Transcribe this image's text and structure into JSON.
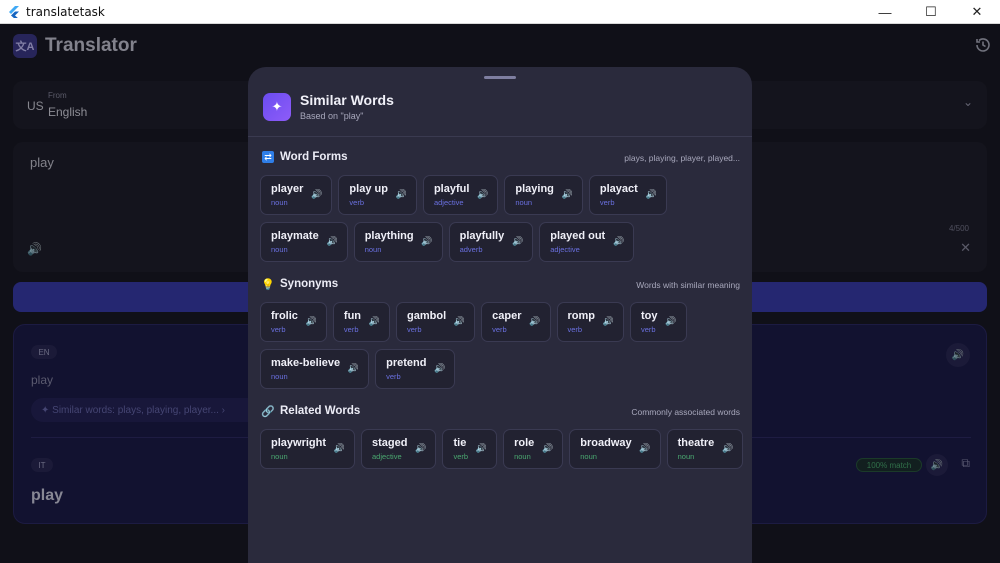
{
  "window": {
    "title": "translatetask",
    "minimize": "—",
    "maximize": "☐",
    "close": "✕"
  },
  "app": {
    "logo": "文A",
    "title": "Translator",
    "language": {
      "code": "US",
      "from_label": "From",
      "name": "English"
    },
    "input": {
      "text": "play",
      "char_count": "4/500"
    },
    "result": {
      "source_badge": "EN",
      "source_text": "play",
      "similar_chip": "✦  Similar words: plays, playing, player...  ›",
      "target_badge": "IT",
      "target_text": "play",
      "match": "100% match"
    }
  },
  "sheet": {
    "title": "Similar Words",
    "subtitle": "Based on \"play\"",
    "sections": [
      {
        "title": "Word Forms",
        "note": "plays, playing, player, played...",
        "icon": "shuffle-icon",
        "color": "#2f7ee8",
        "chips": [
          {
            "word": "player",
            "pos": "noun"
          },
          {
            "word": "play up",
            "pos": "verb"
          },
          {
            "word": "playful",
            "pos": "adjective"
          },
          {
            "word": "playing",
            "pos": "noun"
          },
          {
            "word": "playact",
            "pos": "verb"
          },
          {
            "word": "playmate",
            "pos": "noun"
          },
          {
            "word": "plaything",
            "pos": "noun"
          },
          {
            "word": "playfully",
            "pos": "adverb"
          },
          {
            "word": "played out",
            "pos": "adjective"
          }
        ]
      },
      {
        "title": "Synonyms",
        "note": "Words with similar meaning",
        "icon": "lightbulb-icon",
        "color": "#f2c230",
        "chips": [
          {
            "word": "frolic",
            "pos": "verb"
          },
          {
            "word": "fun",
            "pos": "verb"
          },
          {
            "word": "gambol",
            "pos": "verb"
          },
          {
            "word": "caper",
            "pos": "verb"
          },
          {
            "word": "romp",
            "pos": "verb"
          },
          {
            "word": "toy",
            "pos": "verb"
          },
          {
            "word": "make-believe",
            "pos": "noun"
          },
          {
            "word": "pretend",
            "pos": "verb"
          }
        ]
      },
      {
        "title": "Related Words",
        "note": "Commonly associated words",
        "icon": "link-icon",
        "color": "#c8c8dc",
        "chips": [
          {
            "word": "playwright",
            "pos": "noun"
          },
          {
            "word": "staged",
            "pos": "adjective"
          },
          {
            "word": "tie",
            "pos": "verb"
          },
          {
            "word": "role",
            "pos": "noun"
          },
          {
            "word": "broadway",
            "pos": "noun"
          },
          {
            "word": "theatre",
            "pos": "noun"
          }
        ]
      }
    ]
  }
}
